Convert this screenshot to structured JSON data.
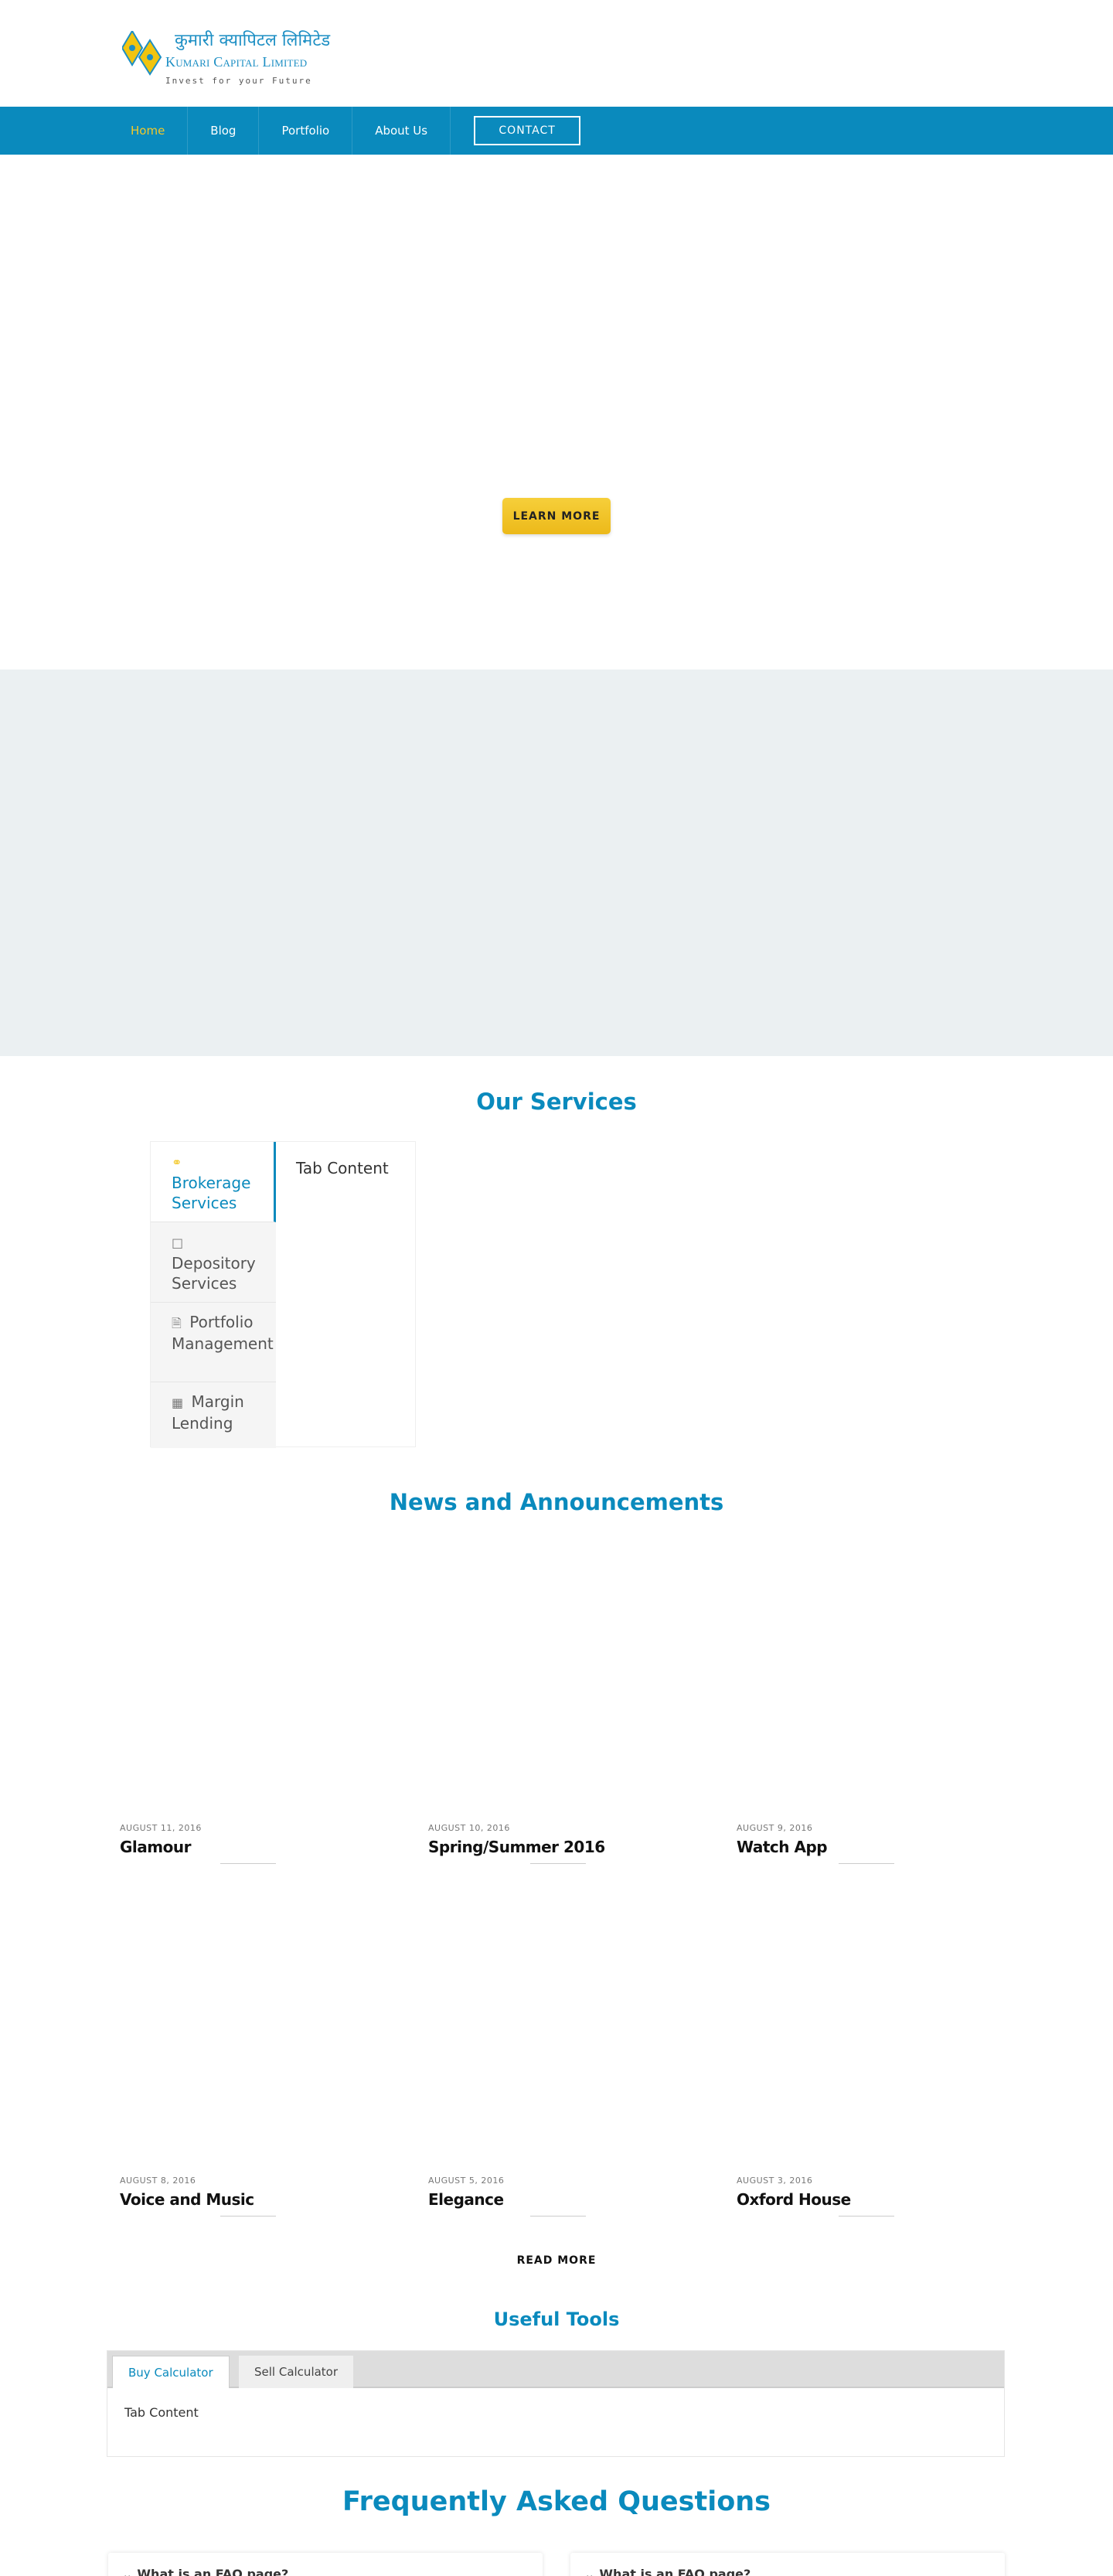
{
  "logo": {
    "name_np": "कुमारी क्यापिटल लिमिटेड",
    "name_en": "Kumari Capital Limited",
    "tagline": "Invest for your Future"
  },
  "nav": {
    "items": [
      {
        "label": "Home",
        "active": true
      },
      {
        "label": "Blog"
      },
      {
        "label": "Portfolio"
      },
      {
        "label": "About Us"
      }
    ],
    "contact_label": "CONTACT"
  },
  "hero": {
    "button_label": "LEARN MORE"
  },
  "services": {
    "title": "Our Services",
    "tabs": [
      {
        "label": "Brokerage Services",
        "icon": "handshake-icon",
        "active": true
      },
      {
        "label": "Depository Services",
        "icon": "box-icon"
      },
      {
        "label": "Portfolio Management",
        "icon": "document-icon"
      },
      {
        "label": "Margin Lending",
        "icon": "money-icon"
      }
    ],
    "content": "Tab Content"
  },
  "news": {
    "title": "News and Announcements",
    "items": [
      {
        "date": "AUGUST 11, 2016",
        "title": "Glamour"
      },
      {
        "date": "AUGUST 10, 2016",
        "title": "Spring/Summer 2016"
      },
      {
        "date": "AUGUST 9, 2016",
        "title": "Watch App"
      },
      {
        "date": "AUGUST 8, 2016",
        "title": "Voice and Music"
      },
      {
        "date": "AUGUST 5, 2016",
        "title": "Elegance"
      },
      {
        "date": "AUGUST 3, 2016",
        "title": "Oxford House"
      }
    ],
    "read_more": "READ MORE"
  },
  "tools": {
    "title": "Useful Tools",
    "tabs": [
      {
        "label": "Buy Calculator",
        "active": true
      },
      {
        "label": "Sell Calculator"
      }
    ],
    "content": "Tab Content"
  },
  "faq": {
    "title": "Frequently Asked Questions",
    "items": [
      {
        "question": "What is an FAQ page?"
      },
      {
        "question": "What is an FAQ page?"
      }
    ]
  },
  "colors": {
    "primary": "#0a8abd",
    "accent": "#f3c829",
    "band": "#ebf0f2"
  }
}
